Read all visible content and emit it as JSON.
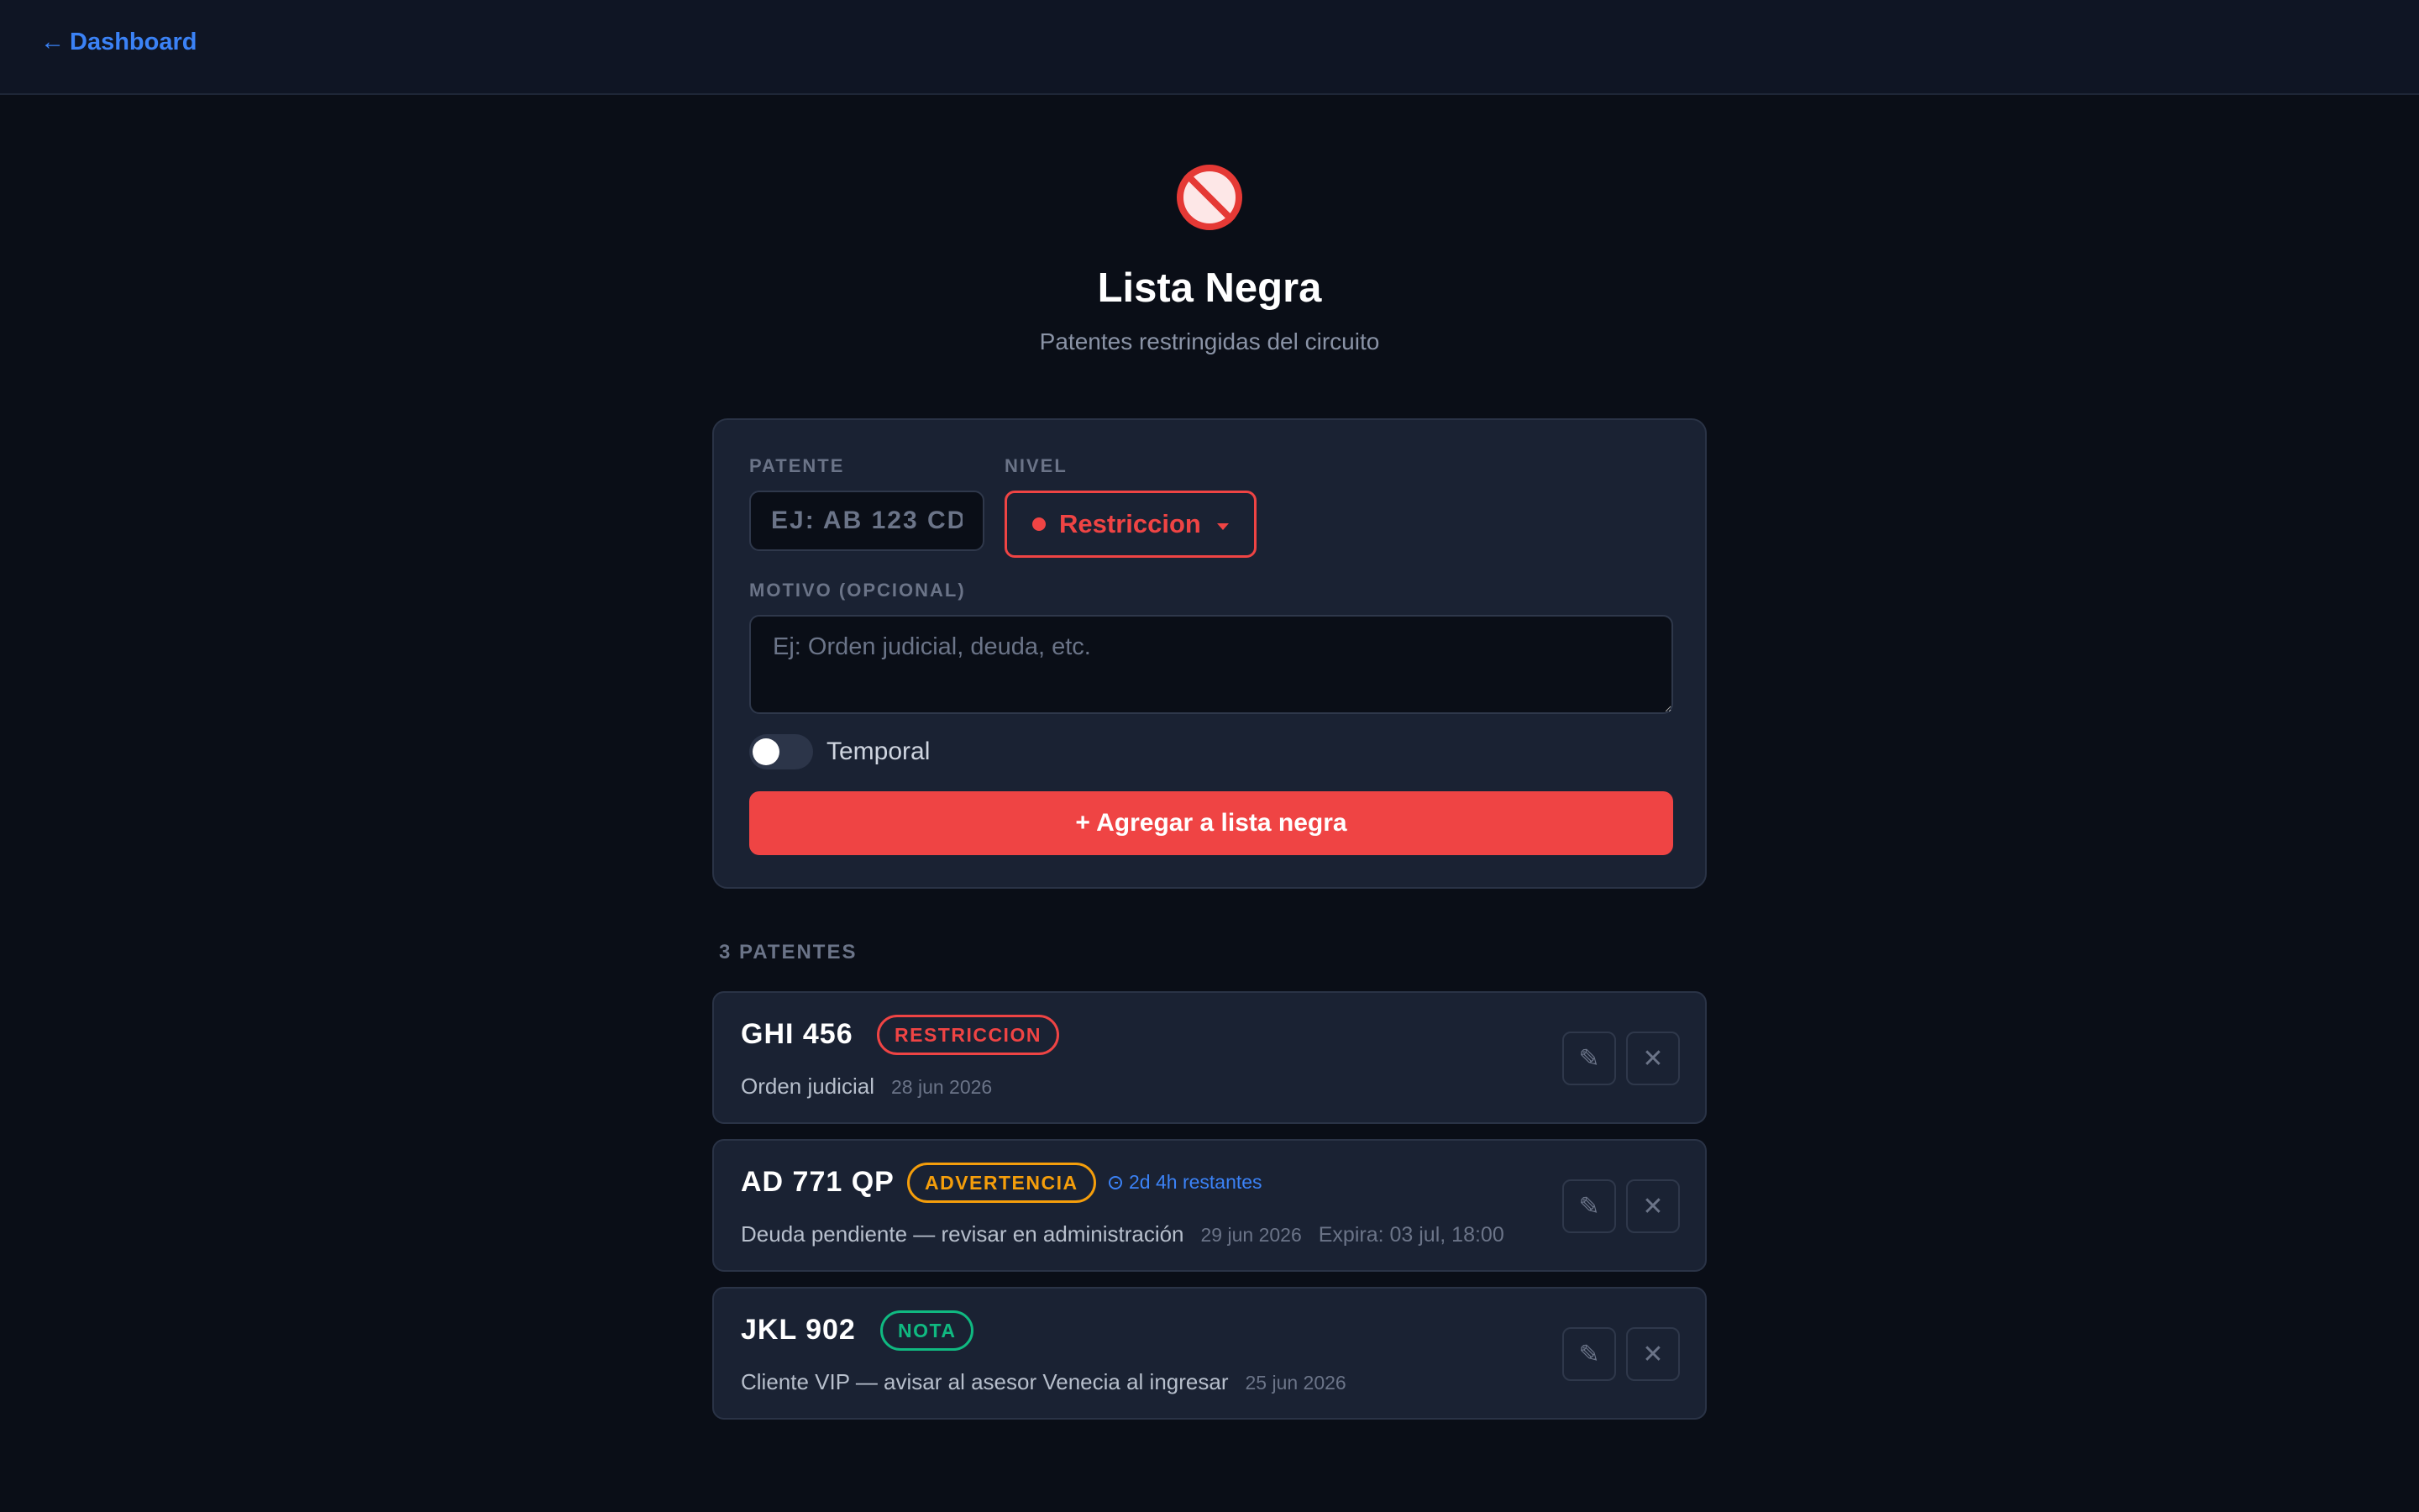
{
  "topbar": {
    "back_arrow": "←",
    "back_label": "Dashboard"
  },
  "hero": {
    "icon": "prohibited-icon",
    "title": "Lista Negra",
    "subtitle": "Patentes restringidas del circuito"
  },
  "form": {
    "patente_label": "PATENTE",
    "patente_placeholder": "EJ: AB 123 CD",
    "patente_value": "",
    "nivel_label": "NIVEL",
    "nivel_selected": "Restriccion",
    "motivo_label": "MOTIVO (OPCIONAL)",
    "motivo_placeholder": "Ej: Orden judicial, deuda, etc.",
    "motivo_value": "",
    "temporal_label": "Temporal",
    "temporal_on": false,
    "add_button_label": "+ Agregar a lista negra"
  },
  "list": {
    "count_label": "3 PATENTES",
    "edit_glyph": "✎",
    "delete_glyph": "✕",
    "entries": [
      {
        "plate": "GHI 456",
        "level": "RESTRICCION",
        "reason": "Orden judicial",
        "date": "28 jun 2026"
      },
      {
        "plate": "AD 771 QP",
        "level": "ADVERTENCIA",
        "remaining": "2d 4h restantes",
        "reason": "Deuda pendiente — revisar en administración",
        "date": "29 jun 2026",
        "expiry": "Expira: 03 jul, 18:00"
      },
      {
        "plate": "JKL 902",
        "level": "NOTA",
        "reason": "Cliente VIP — avisar al asesor Venecia al ingresar",
        "date": "25 jun 2026"
      }
    ]
  },
  "colors": {
    "background": "#0a0e17",
    "card": "#1a2233",
    "accent_blue": "#3b82f6",
    "restriccion": "#ef4444",
    "advertencia": "#f59e0b",
    "nota": "#10b981"
  }
}
